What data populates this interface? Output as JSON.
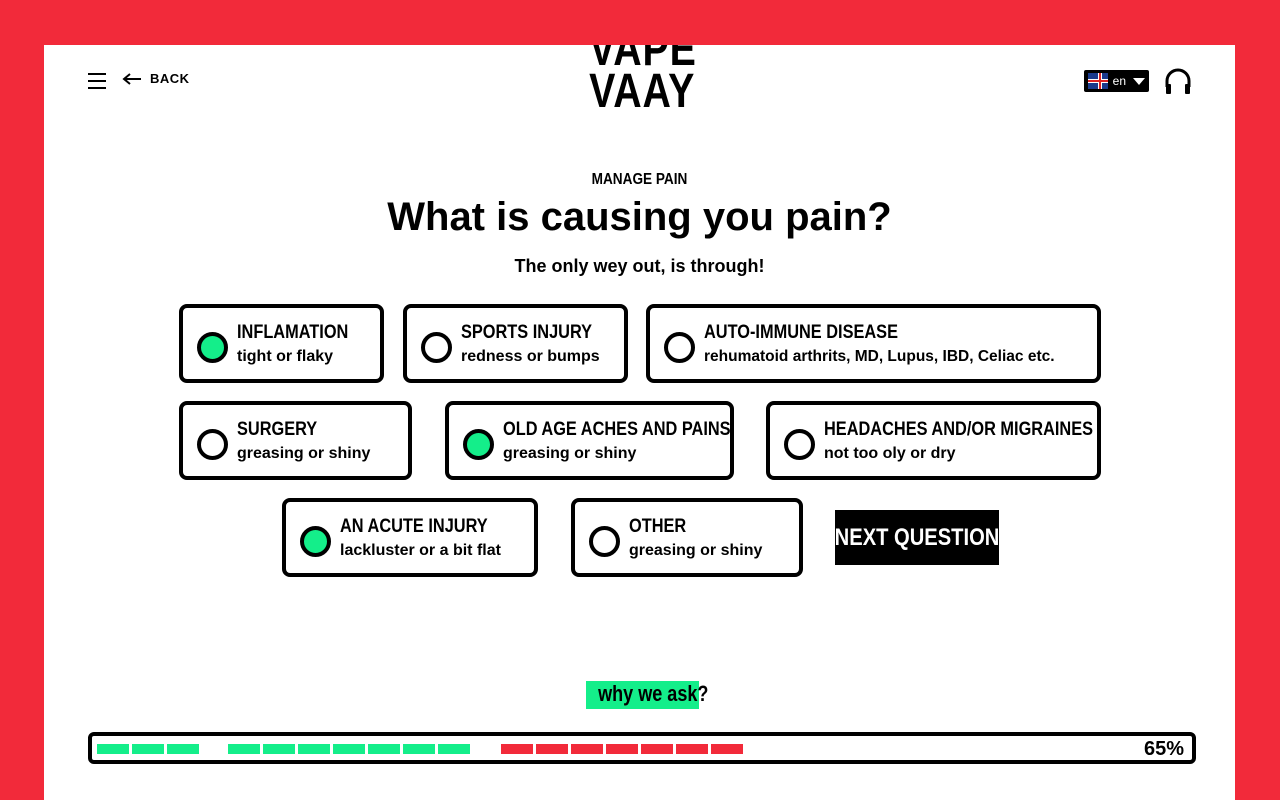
{
  "header": {
    "back_label": "BACK",
    "logo_line1": "VAPE",
    "logo_line2": "VAAY",
    "language": "en"
  },
  "question": {
    "category": "MANAGE PAIN",
    "title": "What is causing you pain?",
    "subtitle": "The only wey out, is through!"
  },
  "options": [
    {
      "title": "INFLAMATION",
      "sub": "tight or flaky",
      "selected": true
    },
    {
      "title": "SPORTS INJURY",
      "sub": "redness or bumps",
      "selected": false
    },
    {
      "title": "AUTO-IMMUNE DISEASE",
      "sub": "rehumatoid arthrits, MD, Lupus, IBD, Celiac etc.",
      "selected": false
    },
    {
      "title": "SURGERY",
      "sub": "greasing or shiny",
      "selected": false
    },
    {
      "title": "OLD AGE ACHES AND PAINS",
      "sub": "greasing or shiny",
      "selected": true
    },
    {
      "title": "HEADACHES AND/OR MIGRAINES",
      "sub": "not too oly or dry",
      "selected": false
    },
    {
      "title": "AN ACUTE INJURY",
      "sub": "lackluster or a bit flat",
      "selected": true
    },
    {
      "title": "OTHER",
      "sub": "greasing or shiny",
      "selected": false
    }
  ],
  "next_label": "NEXT QUESTION",
  "why_label": "why we ask?",
  "progress": {
    "percent_label": "65%",
    "percent": 65
  },
  "colors": {
    "brand_red": "#f22a3a",
    "accent_green": "#14ee8a"
  }
}
